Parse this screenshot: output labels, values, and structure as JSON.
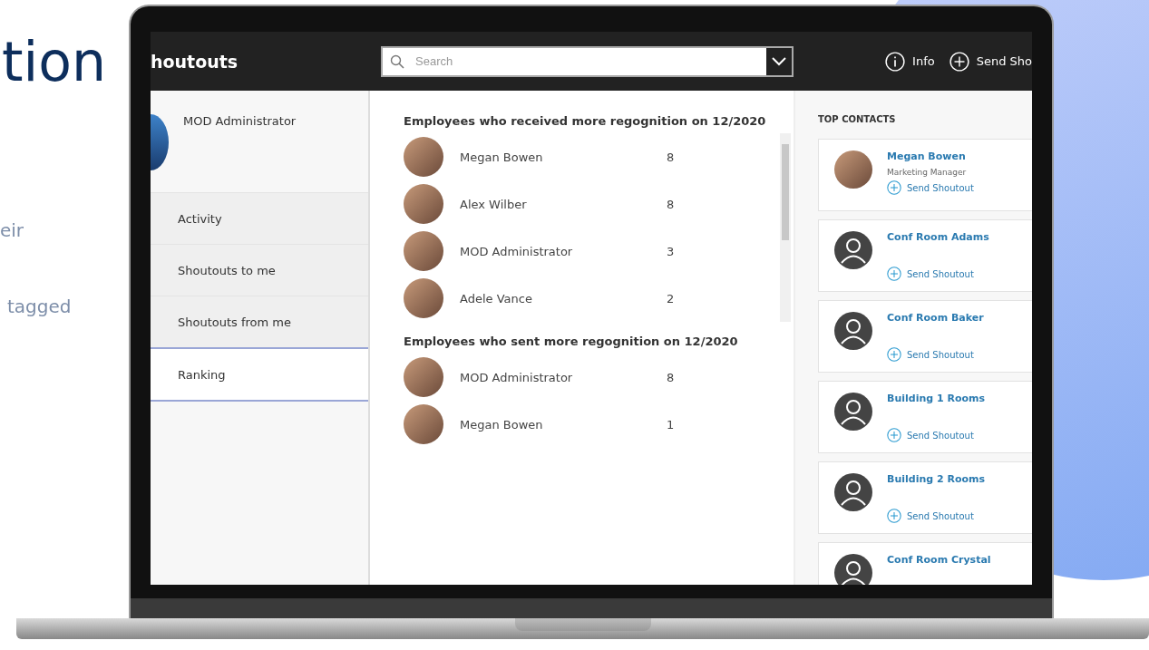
{
  "hero": {
    "title_fragment": "tion",
    "text_fragments": [
      "eir",
      "tagged"
    ]
  },
  "app": {
    "title": "houtouts",
    "search": {
      "placeholder": "Search"
    },
    "actions": [
      {
        "kind": "info",
        "label": "Info"
      },
      {
        "kind": "add",
        "label": "Send Sho"
      }
    ]
  },
  "sidebar": {
    "user": "MOD Administrator",
    "items": [
      {
        "label": "Activity",
        "selected": false
      },
      {
        "label": "Shoutouts to me",
        "selected": false
      },
      {
        "label": "Shoutouts from me",
        "selected": false
      },
      {
        "label": "Ranking",
        "selected": true
      }
    ]
  },
  "ranking": {
    "sections": [
      {
        "title": "Employees who received more regognition on 12/2020",
        "scrollable": true,
        "rows": [
          {
            "name": "Megan Bowen",
            "count": "8"
          },
          {
            "name": "Alex Wilber",
            "count": "8"
          },
          {
            "name": "MOD Administrator",
            "count": "3"
          },
          {
            "name": "Adele Vance",
            "count": "2"
          }
        ]
      },
      {
        "title": "Employees who sent more regognition on 12/2020",
        "scrollable": false,
        "rows": [
          {
            "name": "MOD Administrator",
            "count": "8"
          },
          {
            "name": "Megan Bowen",
            "count": "1"
          }
        ]
      }
    ]
  },
  "top_contacts": {
    "title": "TOP CONTACTS",
    "contacts": [
      {
        "name": "Megan Bowen",
        "role": "Marketing Manager",
        "kind": "photo",
        "action": "Send Shoutout"
      },
      {
        "name": "Conf Room Adams",
        "kind": "generic",
        "action": "Send Shoutout"
      },
      {
        "name": "Conf Room Baker",
        "kind": "generic",
        "action": "Send Shoutout"
      },
      {
        "name": "Building 1 Rooms",
        "kind": "generic",
        "action": "Send Shoutout"
      },
      {
        "name": "Building 2 Rooms",
        "kind": "generic",
        "action": "Send Shoutout"
      },
      {
        "name": "Conf Room Crystal",
        "kind": "generic"
      }
    ]
  }
}
